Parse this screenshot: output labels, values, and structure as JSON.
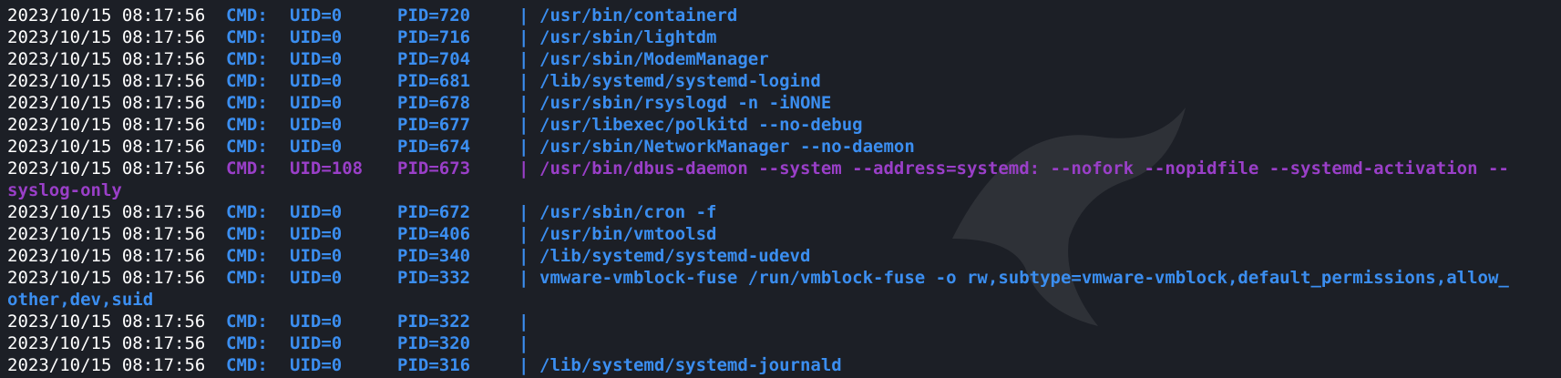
{
  "colors": {
    "background": "#1c1f26",
    "timestamp": "#ffffff",
    "root_process": "#3b8ef0",
    "non_root_process": "#9a3fc8"
  },
  "watermark_icon": "kali-dragon-icon",
  "rows": [
    {
      "ts": "2023/10/15 08:17:56",
      "cmd": "CMD:",
      "uid": "UID=0",
      "pid": "PID=720",
      "bar": "|",
      "path": "/usr/bin/containerd",
      "cont": ""
    },
    {
      "ts": "2023/10/15 08:17:56",
      "cmd": "CMD:",
      "uid": "UID=0",
      "pid": "PID=716",
      "bar": "|",
      "path": "/usr/sbin/lightdm",
      "cont": ""
    },
    {
      "ts": "2023/10/15 08:17:56",
      "cmd": "CMD:",
      "uid": "UID=0",
      "pid": "PID=704",
      "bar": "|",
      "path": "/usr/sbin/ModemManager",
      "cont": ""
    },
    {
      "ts": "2023/10/15 08:17:56",
      "cmd": "CMD:",
      "uid": "UID=0",
      "pid": "PID=681",
      "bar": "|",
      "path": "/lib/systemd/systemd-logind",
      "cont": ""
    },
    {
      "ts": "2023/10/15 08:17:56",
      "cmd": "CMD:",
      "uid": "UID=0",
      "pid": "PID=678",
      "bar": "|",
      "path": "/usr/sbin/rsyslogd -n -iNONE",
      "cont": ""
    },
    {
      "ts": "2023/10/15 08:17:56",
      "cmd": "CMD:",
      "uid": "UID=0",
      "pid": "PID=677",
      "bar": "|",
      "path": "/usr/libexec/polkitd --no-debug",
      "cont": ""
    },
    {
      "ts": "2023/10/15 08:17:56",
      "cmd": "CMD:",
      "uid": "UID=0",
      "pid": "PID=674",
      "bar": "|",
      "path": "/usr/sbin/NetworkManager --no-daemon",
      "cont": ""
    },
    {
      "ts": "2023/10/15 08:17:56",
      "cmd": "CMD:",
      "uid": "UID=108",
      "pid": "PID=673",
      "bar": "|",
      "path": "/usr/bin/dbus-daemon --system --address=systemd: --nofork --nopidfile --systemd-activation --",
      "cont": "syslog-only"
    },
    {
      "ts": "2023/10/15 08:17:56",
      "cmd": "CMD:",
      "uid": "UID=0",
      "pid": "PID=672",
      "bar": "|",
      "path": "/usr/sbin/cron -f",
      "cont": ""
    },
    {
      "ts": "2023/10/15 08:17:56",
      "cmd": "CMD:",
      "uid": "UID=0",
      "pid": "PID=406",
      "bar": "|",
      "path": "/usr/bin/vmtoolsd",
      "cont": ""
    },
    {
      "ts": "2023/10/15 08:17:56",
      "cmd": "CMD:",
      "uid": "UID=0",
      "pid": "PID=340",
      "bar": "|",
      "path": "/lib/systemd/systemd-udevd",
      "cont": ""
    },
    {
      "ts": "2023/10/15 08:17:56",
      "cmd": "CMD:",
      "uid": "UID=0",
      "pid": "PID=332",
      "bar": "|",
      "path": "vmware-vmblock-fuse /run/vmblock-fuse -o rw,subtype=vmware-vmblock,default_permissions,allow_",
      "cont": "other,dev,suid"
    },
    {
      "ts": "2023/10/15 08:17:56",
      "cmd": "CMD:",
      "uid": "UID=0",
      "pid": "PID=322",
      "bar": "|",
      "path": "",
      "cont": ""
    },
    {
      "ts": "2023/10/15 08:17:56",
      "cmd": "CMD:",
      "uid": "UID=0",
      "pid": "PID=320",
      "bar": "|",
      "path": "",
      "cont": ""
    },
    {
      "ts": "2023/10/15 08:17:56",
      "cmd": "CMD:",
      "uid": "UID=0",
      "pid": "PID=316",
      "bar": "|",
      "path": "/lib/systemd/systemd-journald",
      "cont": ""
    }
  ]
}
